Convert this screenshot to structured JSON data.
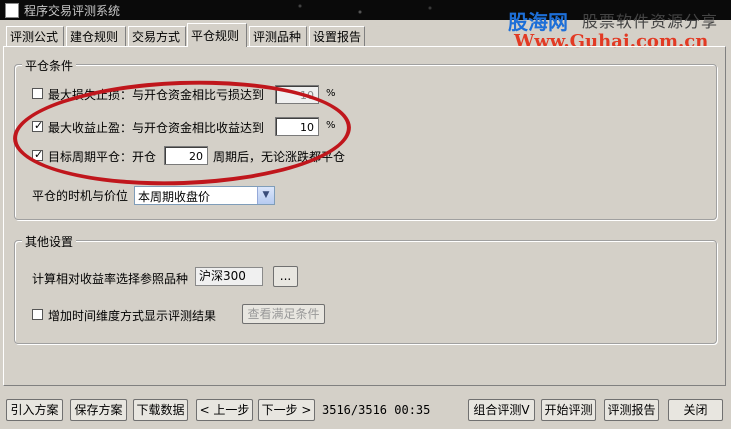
{
  "window": {
    "title": "程序交易评测系统"
  },
  "watermark": {
    "brand": "股海网",
    "slogan": "股票软件资源分享",
    "url": "Www.Guhai.com.cn"
  },
  "tabs": [
    {
      "label": "评测公式"
    },
    {
      "label": "建仓规则"
    },
    {
      "label": "交易方式"
    },
    {
      "label": "平仓规则",
      "active": true
    },
    {
      "label": "评测品种"
    },
    {
      "label": "设置报告"
    }
  ],
  "close_conditions": {
    "group_title": "平仓条件",
    "stop_loss": {
      "label": "最大损失止损：与开仓资金相比亏损达到",
      "value": "10",
      "unit": "%",
      "checked": false
    },
    "take_profit": {
      "label": "最大收益止盈：与开仓资金相比收益达到",
      "value": "10",
      "unit": "%",
      "checked": true
    },
    "target_period": {
      "label": "目标周期平仓：开仓",
      "value": "20",
      "suffix": "周期后，无论涨跌都平仓",
      "checked": true
    },
    "timing": {
      "label": "平仓的时机与价位",
      "selected": "本周期收盘价"
    }
  },
  "other_settings": {
    "group_title": "其他设置",
    "reference": {
      "label": "计算相对收益率选择参照品种",
      "value": "沪深300",
      "browse_label": "..."
    },
    "time_dimension": {
      "label": "增加时间维度方式显示评测结果",
      "checked": false,
      "button_label": "查看满足条件"
    }
  },
  "bottom_bar": {
    "import": "引入方案",
    "save": "保存方案",
    "download": "下载数据",
    "prev": "< 上一步",
    "next": "下一步 >",
    "status": "3516/3516 00:35",
    "combine": "组合评测V",
    "start": "开始评测",
    "report": "评测报告",
    "close": "关闭"
  }
}
